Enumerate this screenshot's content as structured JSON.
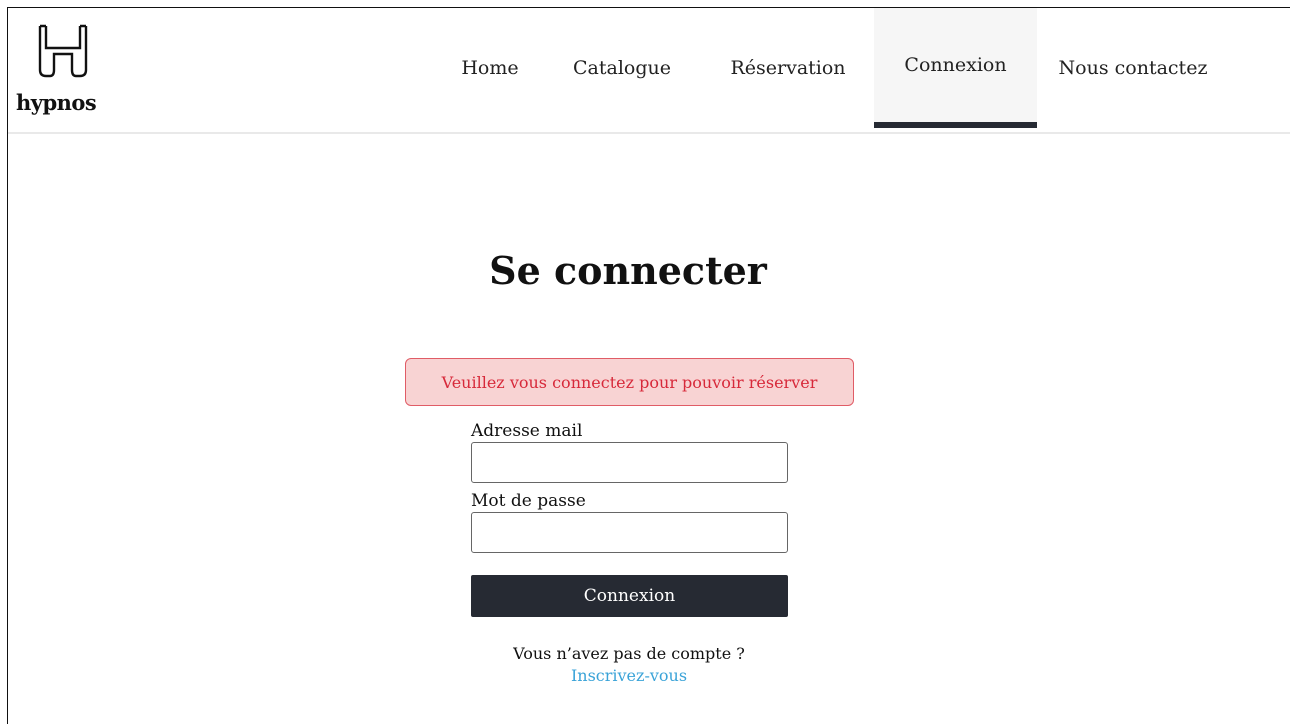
{
  "brand": {
    "name": "hypnos",
    "logo_icon": "hotel-h-logo-icon"
  },
  "nav": {
    "items": [
      {
        "label": "Home",
        "active": false
      },
      {
        "label": "Catalogue",
        "active": false
      },
      {
        "label": "Réservation",
        "active": false
      },
      {
        "label": "Connexion",
        "active": true
      },
      {
        "label": "Nous contactez",
        "active": false
      }
    ]
  },
  "login": {
    "title": "Se connecter",
    "alert": "Veuillez vous connectez pour pouvoir réserver",
    "email_label": "Adresse mail",
    "email_value": "",
    "password_label": "Mot de passe",
    "password_value": "",
    "submit_label": "Connexion",
    "no_account_text": "Vous n’avez pas de compte ?",
    "signup_link": "Inscrivez-vous"
  },
  "colors": {
    "accent_dark": "#262a33",
    "alert_bg": "#f8d3d3",
    "alert_border": "#e05c66",
    "alert_text": "#d7293a",
    "link": "#3aa3d8"
  }
}
